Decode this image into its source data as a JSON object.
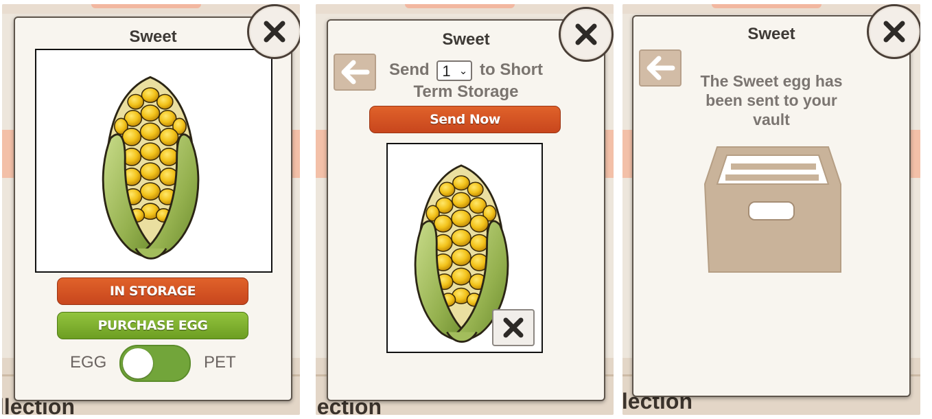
{
  "panels": [
    {
      "title": "Sweet",
      "image_icon": "corn-egg",
      "in_storage_label": "IN STORAGE",
      "purchase_label": "PURCHASE EGG",
      "toggle": {
        "left_label": "EGG",
        "right_label": "PET",
        "state": "EGG"
      },
      "close_icon": "close-x-icon"
    },
    {
      "title": "Sweet",
      "send_prefix": "Send",
      "quantity": "1",
      "send_suffix_1": "to Short",
      "send_suffix_2": "Term Storage",
      "send_now_label": "Send Now",
      "back_icon": "arrow-left-icon",
      "image_icon": "corn-egg",
      "remove_icon": "x-icon",
      "close_icon": "close-x-icon"
    },
    {
      "title": "Sweet",
      "message_line_1": "The Sweet egg has",
      "message_line_2": "been sent to your",
      "message_line_3": "vault",
      "vault_icon": "storage-box-icon",
      "back_icon": "arrow-left-icon",
      "close_icon": "close-x-icon"
    }
  ],
  "background": {
    "heading_fragment": "llection"
  },
  "colors": {
    "accent_red": "#d2531f",
    "accent_green": "#7fb02f",
    "modal_bg": "#f8f5ef",
    "toggle_green": "#72a53a"
  }
}
